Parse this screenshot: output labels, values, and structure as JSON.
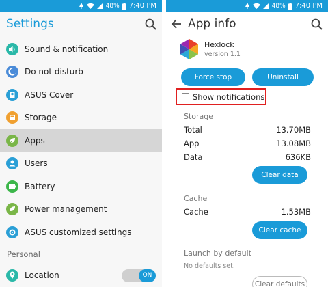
{
  "status": {
    "battery": "48%",
    "time": "7:40 PM"
  },
  "settings": {
    "title": "Settings",
    "items": [
      {
        "label": "Sound & notification",
        "icon": "volume-icon",
        "color": "#2ab8a8"
      },
      {
        "label": "Do not disturb",
        "icon": "moon-icon",
        "color": "#4a8bd8"
      },
      {
        "label": "ASUS Cover",
        "icon": "cover-icon",
        "color": "#2a9fd6"
      },
      {
        "label": "Storage",
        "icon": "storage-icon",
        "color": "#f0a030"
      },
      {
        "label": "Apps",
        "icon": "apps-icon",
        "color": "#7ab648"
      },
      {
        "label": "Users",
        "icon": "users-icon",
        "color": "#2a9fd6"
      },
      {
        "label": "Battery",
        "icon": "battery-icon",
        "color": "#3cb64a"
      },
      {
        "label": "Power management",
        "icon": "power-icon",
        "color": "#7ab648"
      },
      {
        "label": "ASUS customized settings",
        "icon": "asus-settings-icon",
        "color": "#2a9fd6"
      }
    ],
    "active_item": "Apps",
    "personal_header": "Personal",
    "location": {
      "label": "Location",
      "icon": "location-icon",
      "toggle": "ON",
      "color": "#2ab8a8"
    }
  },
  "app_info": {
    "title": "App info",
    "app_name": "Hexlock",
    "version": "version 1.1",
    "force_stop": "Force stop",
    "uninstall": "Uninstall",
    "show_notifications": "Show notifications",
    "storage": {
      "header": "Storage",
      "rows": [
        {
          "label": "Total",
          "value": "13.70MB"
        },
        {
          "label": "App",
          "value": "13.08MB"
        },
        {
          "label": "Data",
          "value": "636KB"
        }
      ],
      "clear_data": "Clear data"
    },
    "cache": {
      "header": "Cache",
      "row": {
        "label": "Cache",
        "value": "1.53MB"
      },
      "clear_cache": "Clear cache"
    },
    "launch": {
      "header": "Launch by default",
      "note": "No defaults set.",
      "clear_defaults": "Clear defaults"
    }
  },
  "colors": {
    "accent": "#1a9bd8",
    "highlight_border": "#e02020",
    "active_row": "#d6d6d6"
  }
}
